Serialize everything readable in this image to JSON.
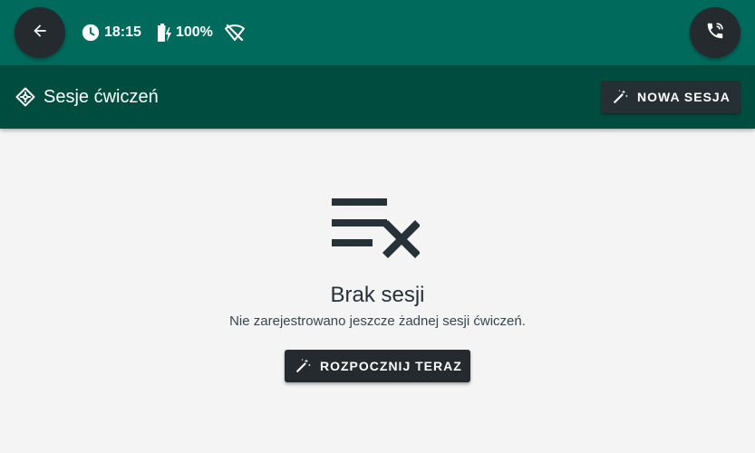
{
  "status": {
    "time": "18:15",
    "battery": "100%",
    "icons": [
      "back-arrow-icon",
      "clock-icon",
      "battery-charging-icon",
      "wifi-off-icon",
      "phone-call-icon"
    ]
  },
  "appbar": {
    "title": "Sesje ćwiczeń",
    "new_session_label": "NOWA SESJA",
    "logo_icon": "exercise-logo-icon"
  },
  "empty_state": {
    "icon": "playlist-remove-icon",
    "title": "Brak sesji",
    "subtitle": "Nie zarejestrowano jeszcze żadnej sesji ćwiczeń.",
    "start_label": "ROZPOCZNIJ TERAZ"
  },
  "colors": {
    "status_bar": "#006b5c",
    "app_bar": "#004d40",
    "background": "#f3f4f3",
    "button": "#252a2e",
    "text_dark": "#263238"
  }
}
